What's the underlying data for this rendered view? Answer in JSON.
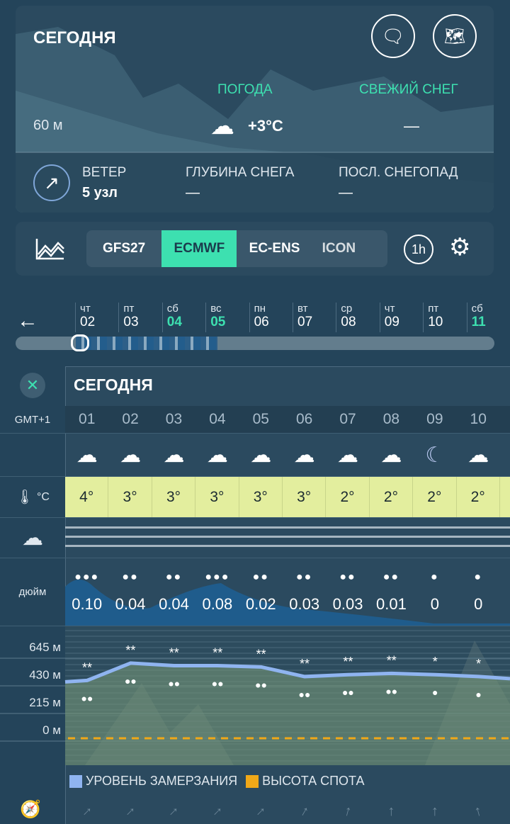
{
  "header": {
    "title": "СЕГОДНЯ",
    "elevation": "60 м",
    "weather_label": "ПОГОДА",
    "fresh_snow_label": "СВЕЖИЙ СНЕГ",
    "temperature": "+3°C",
    "fresh_snow_value": "—",
    "weather_icon": "cloud-icon"
  },
  "stats": {
    "wind_label": "ВЕТЕР",
    "wind_value": "5 узл",
    "snow_depth_label": "ГЛУБИНА СНЕГА",
    "snow_depth_value": "—",
    "last_snowfall_label": "ПОСЛ. СНЕГОПАД",
    "last_snowfall_value": "—"
  },
  "models": {
    "tabs": [
      "GFS27",
      "ECMWF",
      "EC-ENS",
      "ICON"
    ],
    "active": "ECMWF",
    "interval": "1h"
  },
  "days": [
    {
      "w": "чт",
      "d": "02"
    },
    {
      "w": "пт",
      "d": "03"
    },
    {
      "w": "сб",
      "d": "04",
      "weekend": true
    },
    {
      "w": "вс",
      "d": "05",
      "weekend": true
    },
    {
      "w": "пн",
      "d": "06"
    },
    {
      "w": "вт",
      "d": "07"
    },
    {
      "w": "ср",
      "d": "08"
    },
    {
      "w": "чт",
      "d": "09"
    },
    {
      "w": "пт",
      "d": "10"
    },
    {
      "w": "сб",
      "d": "11",
      "weekend": true
    }
  ],
  "table": {
    "title": "СЕГОДНЯ",
    "timezone": "GMT+1",
    "temp_unit": "°C",
    "precip_unit": "дюйм",
    "hours": [
      "01",
      "02",
      "03",
      "04",
      "05",
      "06",
      "07",
      "08",
      "09",
      "10"
    ],
    "icons": [
      "cloud-rain",
      "cloud-rain",
      "cloud-rain",
      "cloud-rain",
      "cloud-rain",
      "cloud-rain",
      "cloud-rain",
      "cloud-rain",
      "moon",
      "cloud-rain"
    ],
    "temps": [
      "4°",
      "3°",
      "3°",
      "3°",
      "3°",
      "3°",
      "2°",
      "2°",
      "2°",
      "2°"
    ],
    "precip": [
      "0.10",
      "0.04",
      "0.04",
      "0.08",
      "0.02",
      "0.03",
      "0.03",
      "0.01",
      "0",
      "0"
    ]
  },
  "chart_data": {
    "type": "line",
    "ylabels": [
      "645 м",
      "430 м",
      "215 м",
      "0 м"
    ],
    "ylim": [
      0,
      800
    ],
    "x": [
      "01",
      "02",
      "03",
      "04",
      "05",
      "06",
      "07",
      "08",
      "09",
      "10"
    ],
    "series": [
      {
        "name": "УРОВЕНЬ ЗАМЕРЗАНИЯ",
        "color": "#8fb4f0",
        "values": [
          450,
          585,
          565,
          565,
          555,
          480,
          495,
          505,
          495,
          480
        ]
      },
      {
        "name": "ВЫСОТА СПОТА",
        "color": "#f0a818",
        "values": [
          0,
          0,
          0,
          0,
          0,
          0,
          0,
          0,
          0,
          0
        ]
      }
    ]
  },
  "wind_dirs": [
    45,
    45,
    45,
    45,
    45,
    30,
    15,
    0,
    0,
    -15
  ]
}
